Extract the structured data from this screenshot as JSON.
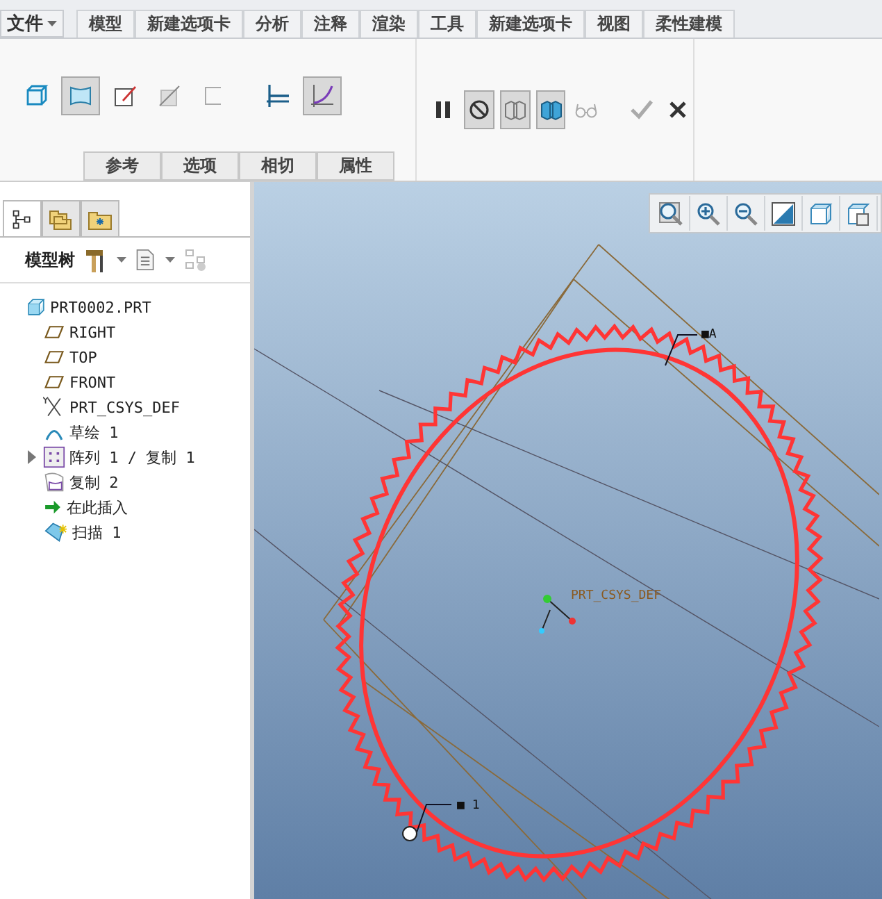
{
  "menu_bar": {
    "file_menu": "文件",
    "tabs": [
      {
        "label": "模型",
        "selected": false
      },
      {
        "label": "新建选项卡",
        "selected": false
      },
      {
        "label": "分析",
        "selected": false
      },
      {
        "label": "注释",
        "selected": false
      },
      {
        "label": "渲染",
        "selected": false
      },
      {
        "label": "工具",
        "selected": false
      },
      {
        "label": "新建选项卡",
        "selected": false
      },
      {
        "label": "视图",
        "selected": false
      },
      {
        "label": "柔性建模",
        "selected": false
      }
    ]
  },
  "ribbon": {
    "shape_tools": [
      {
        "kind": "solid",
        "selected": false
      },
      {
        "kind": "surface",
        "selected": true
      },
      {
        "kind": "sketch",
        "selected": false
      },
      {
        "kind": "remove",
        "selected": false
      },
      {
        "kind": "thicken",
        "selected": false
      },
      {
        "kind": "constant",
        "selected": false
      },
      {
        "kind": "variable",
        "selected": true
      }
    ],
    "sub_tabs": [
      {
        "label": "参考",
        "selected": false
      },
      {
        "label": "选项",
        "selected": false
      },
      {
        "label": "相切",
        "selected": false
      },
      {
        "label": "属性",
        "selected": false
      }
    ],
    "control_tools": [
      {
        "kind": "pause",
        "selected": false
      },
      {
        "kind": "stop",
        "selected": true
      },
      {
        "kind": "preview",
        "selected": true
      },
      {
        "kind": "verify",
        "selected": true
      },
      {
        "kind": "glasses",
        "selected": false
      },
      {
        "kind": "ok",
        "selected": false
      },
      {
        "kind": "cancel",
        "selected": false
      }
    ]
  },
  "navigator": {
    "tabs": [
      {
        "kind": "tree",
        "selected": true
      },
      {
        "kind": "folders",
        "selected": false
      },
      {
        "kind": "favorites",
        "selected": false
      }
    ],
    "title": "模型树",
    "tree": [
      {
        "label": "PRT0002.PRT",
        "kind": "part",
        "children": [
          {
            "label": "RIGHT",
            "kind": "plane"
          },
          {
            "label": "TOP",
            "kind": "plane"
          },
          {
            "label": "FRONT",
            "kind": "plane"
          },
          {
            "label": "PRT_CSYS_DEF",
            "kind": "csys"
          },
          {
            "label": "草绘 1",
            "kind": "sketch"
          },
          {
            "label": "阵列 1 / 复制 1",
            "kind": "pattern",
            "expanded": false
          },
          {
            "label": "复制 2",
            "kind": "copy"
          },
          {
            "label": "在此插入",
            "kind": "insert"
          },
          {
            "label": "扫描 1",
            "kind": "sweep"
          }
        ]
      }
    ]
  },
  "graphics": {
    "view_tools": [
      {
        "kind": "refit"
      },
      {
        "kind": "zoom_in"
      },
      {
        "kind": "zoom_out"
      },
      {
        "kind": "repaint"
      },
      {
        "kind": "view"
      },
      {
        "kind": "saved_views"
      }
    ],
    "labels": [
      {
        "text": "■A",
        "kind": "leader_top"
      },
      {
        "text": "PRT_CSYS_DEF",
        "kind": "csys"
      },
      {
        "text": "■ 1",
        "kind": "leader_bottom"
      }
    ]
  }
}
